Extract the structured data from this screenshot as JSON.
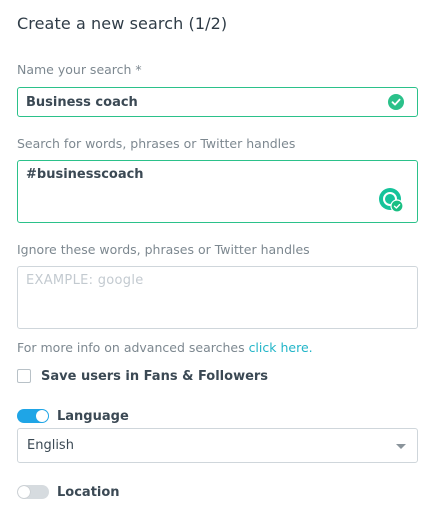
{
  "form": {
    "title": "Create a new search (1/2)",
    "name_label": "Name your search *",
    "name_value": "Business coach",
    "words_label": "Search for words, phrases or Twitter handles",
    "words_value": "#businesscoach",
    "ignore_label": "Ignore these words, phrases or Twitter handles",
    "ignore_placeholder": "EXAMPLE: google",
    "info_text": "For more info on advanced searches ",
    "info_link": "click here.",
    "save_users_label": "Save users in Fans & Followers",
    "save_users_checked": false,
    "language_label": "Language",
    "language_enabled": true,
    "language_selected": "English",
    "location_label": "Location",
    "location_enabled": false
  },
  "colors": {
    "valid_border": "#2bc18a",
    "link": "#22b5c8",
    "toggle_on": "#1fa5e6",
    "toggle_off": "#d6dbdf"
  },
  "icons": {
    "name_status": "check-circle-icon",
    "grammar_helper": "grammarly-icon",
    "select_caret": "caret-down-icon"
  }
}
